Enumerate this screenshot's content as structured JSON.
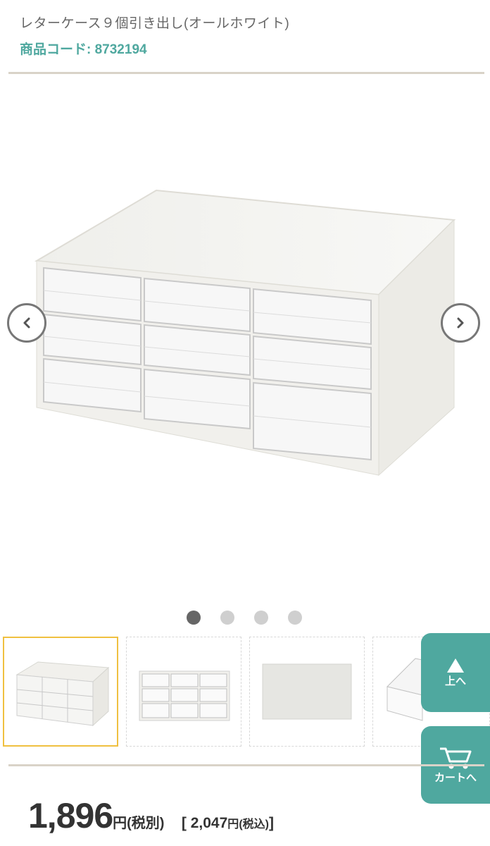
{
  "product": {
    "title": "レターケース９個引き出し(オールホワイト)",
    "code_label": "商品コード: 8732194"
  },
  "gallery": {
    "slide_count": 4,
    "active_index": 0,
    "thumbnails": [
      "thumb-front",
      "thumb-drawers",
      "thumb-top",
      "thumb-side"
    ]
  },
  "floating": {
    "to_top_label": "上へ",
    "cart_label": "カートへ"
  },
  "price": {
    "amount": "1,896",
    "yen": "円",
    "tax_excl": "(税別)",
    "incl_open": "[ ",
    "incl_amount": "2,047",
    "incl_yen": "円",
    "incl_tax": "(税込)",
    "incl_close": "]"
  },
  "colors": {
    "accent": "#4fa89f",
    "divider": "#d9d3c8",
    "selected_thumb": "#f0c040"
  }
}
